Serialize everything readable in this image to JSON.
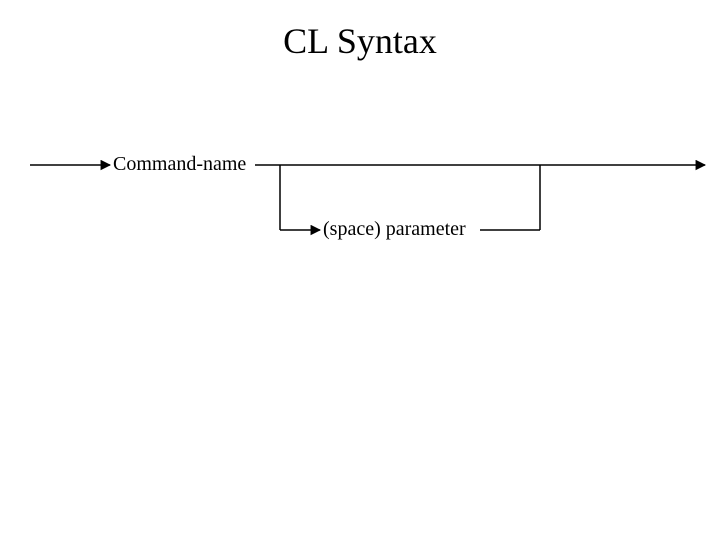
{
  "title": "CL Syntax",
  "diagram": {
    "command_label": "Command-name",
    "parameter_label": "(space) parameter"
  }
}
